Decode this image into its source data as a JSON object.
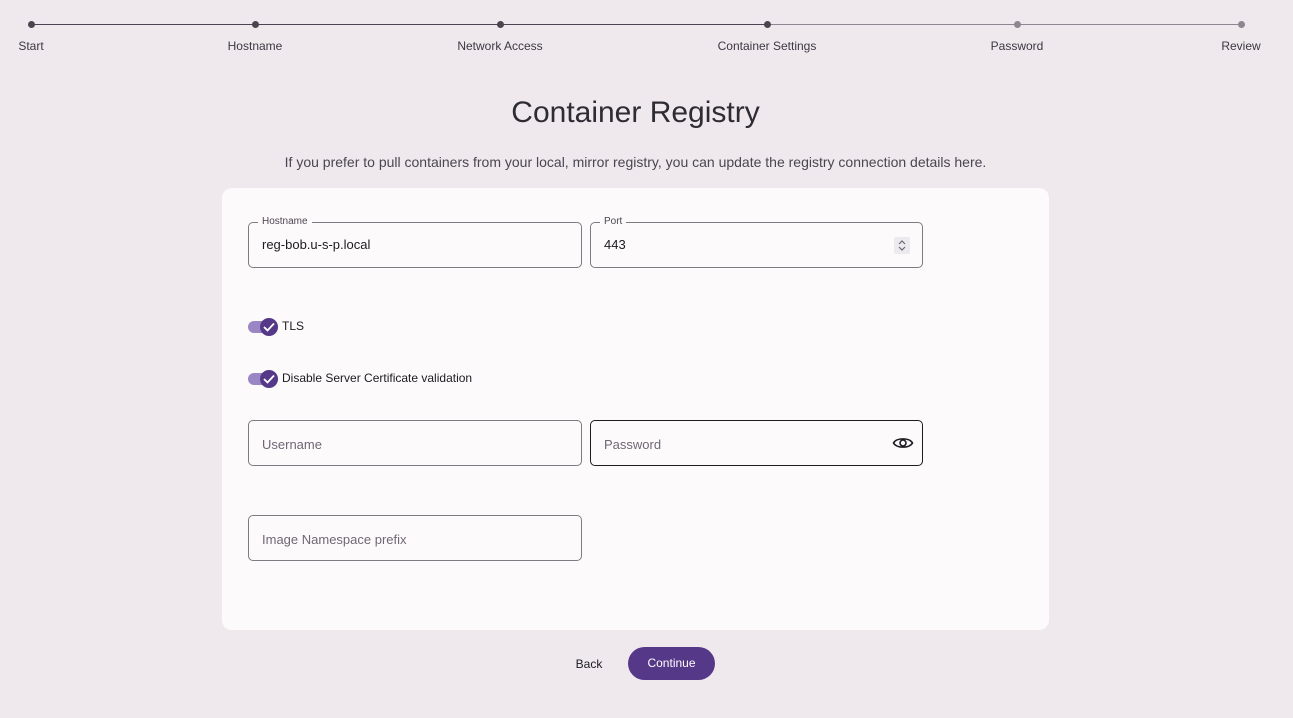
{
  "stepper": {
    "steps": [
      {
        "label": "Start",
        "state": "done"
      },
      {
        "label": "Hostname",
        "state": "done"
      },
      {
        "label": "Network Access",
        "state": "done"
      },
      {
        "label": "Container Settings",
        "state": "current"
      },
      {
        "label": "Password",
        "state": "todo"
      },
      {
        "label": "Review",
        "state": "todo"
      }
    ]
  },
  "page": {
    "title": "Container Registry",
    "description": "If you prefer to pull containers from your local, mirror registry, you can update the registry connection details here."
  },
  "form": {
    "hostname": {
      "label": "Hostname",
      "value": "reg-bob.u-s-p.local"
    },
    "port": {
      "label": "Port",
      "value": "443"
    },
    "tls": {
      "label": "TLS",
      "checked": true
    },
    "disable_cert_validation": {
      "label": "Disable Server Certificate validation",
      "checked": true
    },
    "username": {
      "placeholder": "Username",
      "value": ""
    },
    "password": {
      "placeholder": "Password",
      "value": ""
    },
    "namespace_prefix": {
      "placeholder": "Image Namespace prefix",
      "value": ""
    }
  },
  "actions": {
    "back_label": "Back",
    "continue_label": "Continue"
  },
  "icons": {
    "toggle_check": "check-icon",
    "password_visibility": "eye-icon",
    "port_spinner": "spinner-arrows-icon"
  },
  "colors": {
    "accent": "#563888",
    "toggle_track": "#9a86c4",
    "background": "#efe9ee",
    "card": "#fdfafc"
  }
}
